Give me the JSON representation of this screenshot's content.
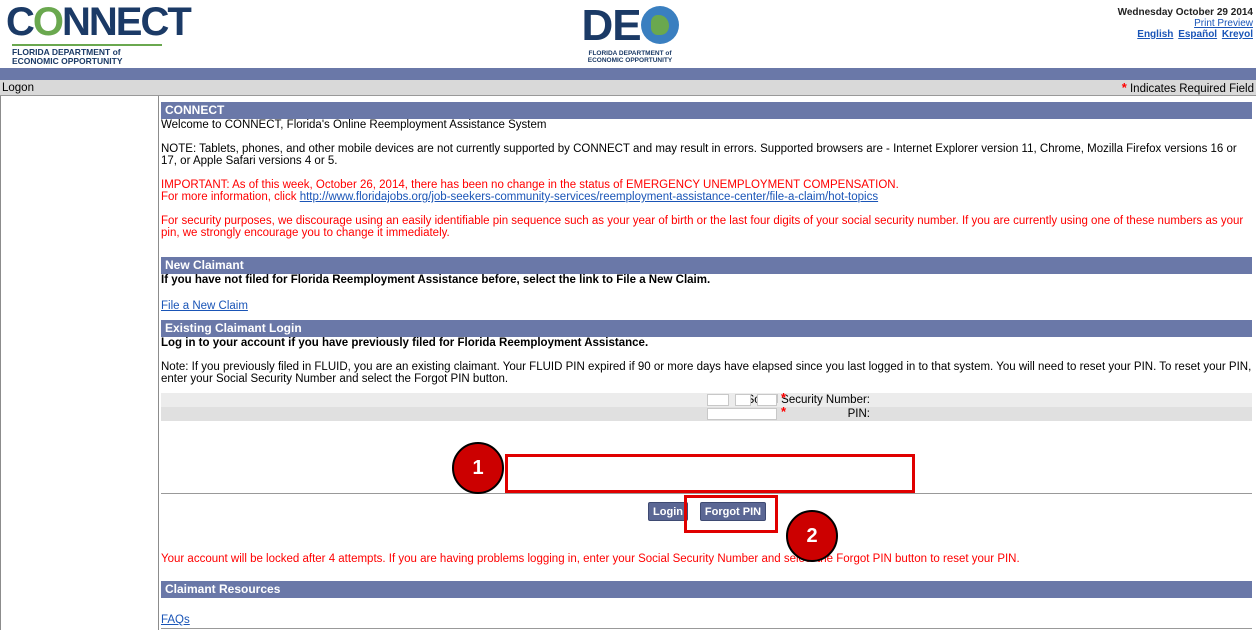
{
  "header": {
    "connect_logo": {
      "word_pre": "C",
      "word_o": "O",
      "word_post": "NNECT",
      "sub_line1": "FLORIDA DEPARTMENT of",
      "sub_line2": "ECONOMIC OPPORTUNITY"
    },
    "deo_logo": {
      "word_pre": "DE",
      "sub_line1": "FLORIDA DEPARTMENT of",
      "sub_line2": "ECONOMIC OPPORTUNITY"
    },
    "date": "Wednesday October 29 2014",
    "print_preview": "Print Preview",
    "languages": [
      "English",
      "Español",
      "Kreyol"
    ]
  },
  "breadcrumb": "Logon",
  "required_note": {
    "star": "*",
    "text": "Indicates Required Field"
  },
  "sections": {
    "connect": {
      "title": "CONNECT",
      "welcome": "Welcome to CONNECT, Florida's Online Reemployment Assistance System",
      "note": "NOTE: Tablets, phones, and other mobile devices are not currently supported by CONNECT and may result in errors. Supported browsers are - Internet Explorer version 11, Chrome, Mozilla Firefox versions 16 or 17, or Apple Safari versions 4 or 5.",
      "important": "IMPORTANT: As of this week, October 26, 2014, there has been no change in the status of EMERGENCY UNEMPLOYMENT COMPENSATION.",
      "more_info_prefix": "For more information, click ",
      "more_info_link": "http://www.floridajobs.org/job-seekers-community-services/reemployment-assistance-center/file-a-claim/hot-topics",
      "security": "For security purposes, we discourage using an easily identifiable pin sequence such as your year of birth or the last four digits of your social security number. If you are currently using one of these numbers as your pin, we strongly encourage you to change it immediately."
    },
    "new_claimant": {
      "title": "New Claimant",
      "instruction": "If you have not filed for Florida Reemployment Assistance before, select the link to File a New Claim.",
      "link": "File a New Claim"
    },
    "existing": {
      "title": "Existing Claimant Login",
      "instruction": "Log in to your account if you have previously filed for Florida Reemployment Assistance.",
      "note": "Note: If you previously filed in FLUID, you are an existing claimant. Your FLUID PIN expired if 90 or more days have elapsed since you last logged in to that system. You will need to reset your PIN. To reset your PIN, enter your Social Security Number and select the Forgot PIN button.",
      "ssn_label": "Social Security Number:",
      "pin_label": "PIN:",
      "login_button": "Login",
      "forgot_button": "Forgot PIN",
      "lockout": "Your account will be locked after 4 attempts. If you are having problems logging in, enter your Social Security Number and select the Forgot PIN button to reset your PIN."
    },
    "resources": {
      "title": "Claimant Resources",
      "faqs": "FAQs"
    }
  },
  "callouts": {
    "one": "1",
    "two": "2"
  },
  "colors": {
    "section_header": "#6a78a8",
    "callout_red": "#e00000",
    "link_blue": "#1a55b7"
  }
}
